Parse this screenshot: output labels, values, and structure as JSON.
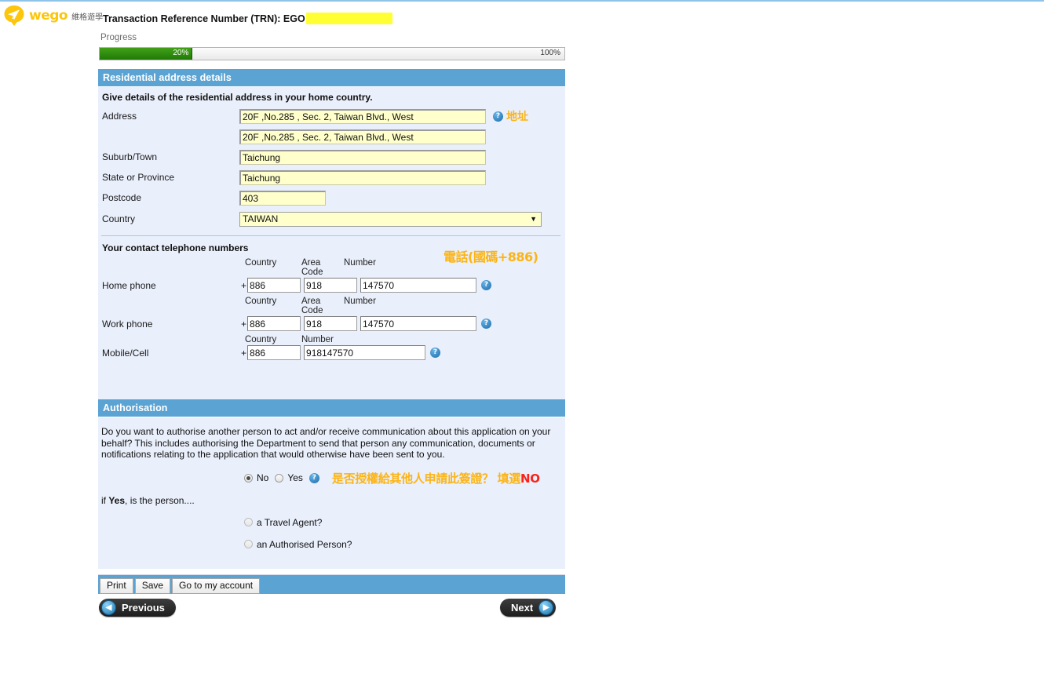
{
  "brand": {
    "name": "wego",
    "cn_name": "維格遊學",
    "logo_icon": "paper-plane-pin-icon",
    "color": "#fcc60a"
  },
  "header": {
    "trn_label": "Transaction Reference Number (TRN): EGO",
    "redacted": true
  },
  "progress": {
    "label": "Progress",
    "value_text": "20%",
    "max_text": "100%",
    "percent": 20,
    "fill_color": "#2f8f0e"
  },
  "address_section": {
    "title": "Residential address details",
    "intro": "Give details of the residential address in your home country.",
    "fields": [
      {
        "label": "Address",
        "value": "20F ,No.285 , Sec. 2, Taiwan Blvd., West"
      },
      {
        "label": "",
        "value": "20F ,No.285 , Sec. 2, Taiwan Blvd., West"
      },
      {
        "label": "Suburb/Town",
        "value": "Taichung"
      },
      {
        "label": "State or Province",
        "value": "Taichung"
      },
      {
        "label": "Postcode",
        "value": "403"
      }
    ],
    "country": {
      "label": "Country",
      "value": "TAIWAN"
    },
    "annotation": "地址",
    "annotation_color": "#fcb415",
    "help_icon": "help-question-icon"
  },
  "phone_section": {
    "title": "Your contact telephone numbers",
    "annotation": "電話(國碼+886)",
    "annotation_color": "#fcb415",
    "col_country": "Country",
    "col_area": "Area Code",
    "col_number": "Number",
    "rows": [
      {
        "label": "Home phone",
        "country": "886",
        "area": "918",
        "number": "147570"
      },
      {
        "label": "Work phone",
        "country": "886",
        "area": "918",
        "number": "147570"
      }
    ],
    "mobile": {
      "label": "Mobile/Cell",
      "country": "886",
      "number": "918147570"
    },
    "prefix": "+"
  },
  "authorisation": {
    "title": "Authorisation",
    "question": "Do you want to authorise another person to act and/or receive communication about this application on your behalf? This includes authorising the Department to send that person any communication, documents or notifications relating to the application that would otherwise have been sent to you.",
    "option_no": "No",
    "option_yes": "Yes",
    "selected": "No",
    "annotation": "是否授權給其他人申請此簽證？ 填選",
    "annotation_emphasis": "NO",
    "annotation_color": "#fcb415",
    "annotation_emphasis_color": "#f8241c",
    "if_yes_prefix": "if ",
    "if_yes_bold": "Yes",
    "if_yes_suffix": ", is the person....",
    "sub_options": [
      {
        "label": "a Travel Agent?",
        "selected": false
      },
      {
        "label": "an Authorised Person?",
        "selected": false
      }
    ]
  },
  "actions": {
    "print": "Print",
    "save": "Save",
    "account": "Go to my account",
    "previous": "Previous",
    "next": "Next",
    "prev_icon": "chevron-left-icon",
    "next_icon": "chevron-right-icon"
  }
}
